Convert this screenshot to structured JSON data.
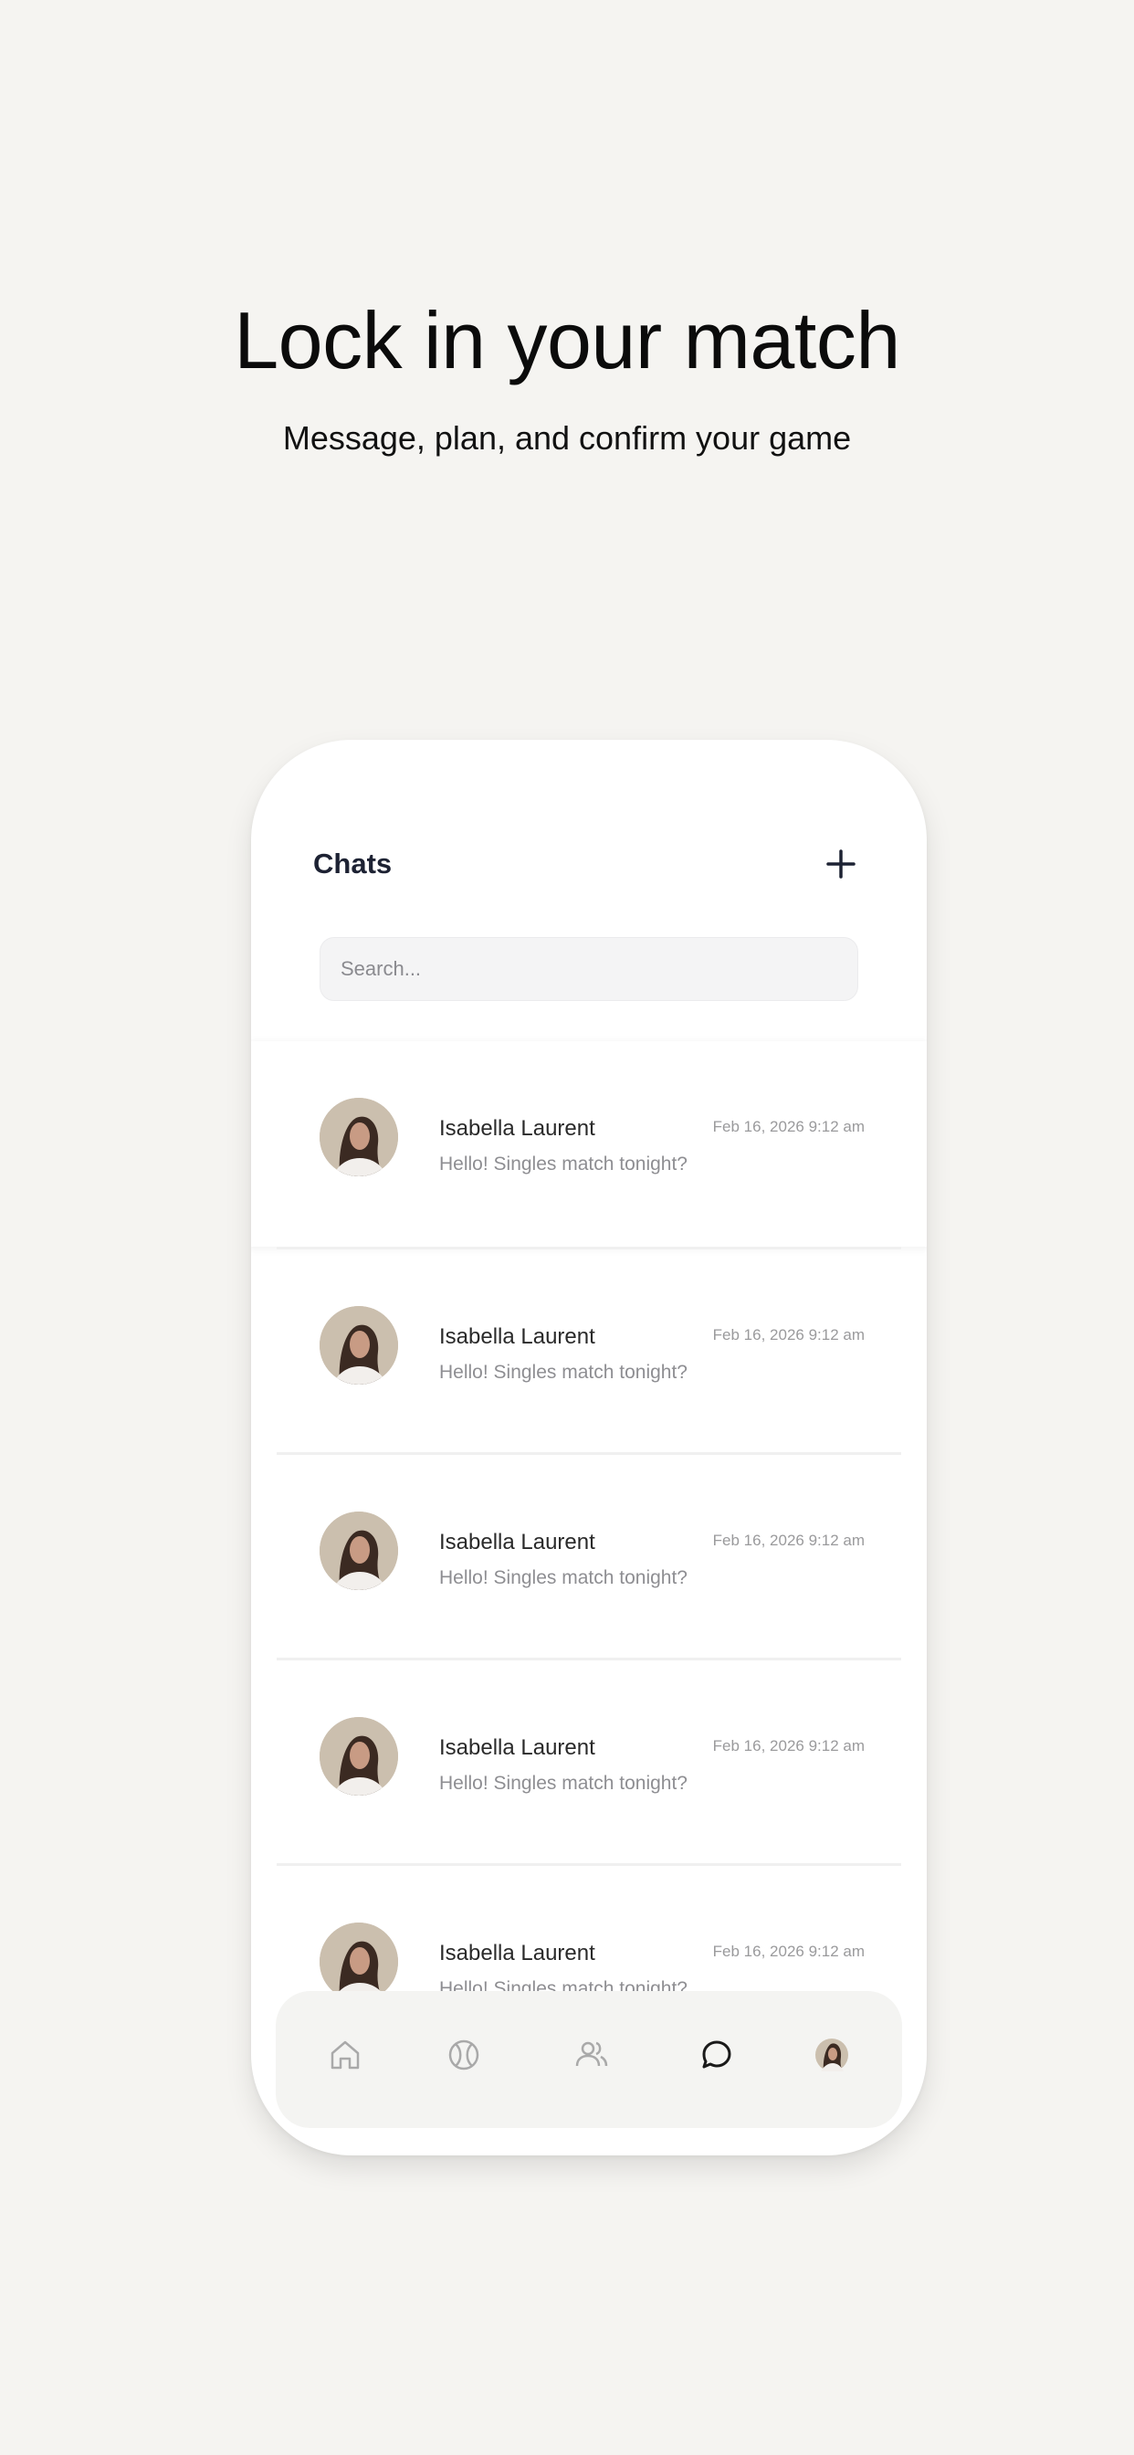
{
  "hero": {
    "title": "Lock in your match",
    "subtitle": "Message, plan, and confirm your game"
  },
  "chats": {
    "title": "Chats",
    "add_icon": "plus-icon",
    "search_placeholder": "Search...",
    "items": [
      {
        "name": "Isabella Laurent",
        "message": "Hello! Singles match tonight?",
        "time": "Feb 16, 2026 9:12 am"
      },
      {
        "name": "Isabella Laurent",
        "message": "Hello! Singles match tonight?",
        "time": "Feb 16, 2026 9:12 am"
      },
      {
        "name": "Isabella Laurent",
        "message": "Hello! Singles match tonight?",
        "time": "Feb 16, 2026 9:12 am"
      },
      {
        "name": "Isabella Laurent",
        "message": "Hello! Singles match tonight?",
        "time": "Feb 16, 2026 9:12 am"
      },
      {
        "name": "Isabella Laurent",
        "message": "Hello! Singles match tonight?",
        "time": "Feb 16, 2026 9:12 am"
      }
    ]
  },
  "tabbar": {
    "items": [
      "home-icon",
      "tennis-ball-icon",
      "users-icon",
      "chat-icon",
      "profile-avatar"
    ],
    "active": "chat-icon"
  },
  "colors": {
    "background": "#f5f4f1",
    "phone": "#ffffff",
    "header_text": "#1d2233",
    "muted_text": "#8e8e92",
    "tab_active": "#1a1a1a",
    "tab_inactive": "#a9a9a9"
  }
}
